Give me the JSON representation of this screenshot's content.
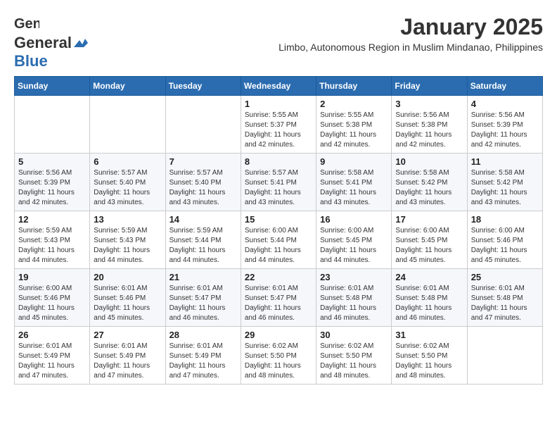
{
  "logo": {
    "general": "General",
    "blue": "Blue"
  },
  "title": {
    "month_year": "January 2025",
    "subtitle": "Limbo, Autonomous Region in Muslim Mindanao, Philippines"
  },
  "headers": [
    "Sunday",
    "Monday",
    "Tuesday",
    "Wednesday",
    "Thursday",
    "Friday",
    "Saturday"
  ],
  "weeks": [
    [
      {
        "num": "",
        "info": ""
      },
      {
        "num": "",
        "info": ""
      },
      {
        "num": "",
        "info": ""
      },
      {
        "num": "1",
        "info": "Sunrise: 5:55 AM\nSunset: 5:37 PM\nDaylight: 11 hours\nand 42 minutes."
      },
      {
        "num": "2",
        "info": "Sunrise: 5:55 AM\nSunset: 5:38 PM\nDaylight: 11 hours\nand 42 minutes."
      },
      {
        "num": "3",
        "info": "Sunrise: 5:56 AM\nSunset: 5:38 PM\nDaylight: 11 hours\nand 42 minutes."
      },
      {
        "num": "4",
        "info": "Sunrise: 5:56 AM\nSunset: 5:39 PM\nDaylight: 11 hours\nand 42 minutes."
      }
    ],
    [
      {
        "num": "5",
        "info": "Sunrise: 5:56 AM\nSunset: 5:39 PM\nDaylight: 11 hours\nand 42 minutes."
      },
      {
        "num": "6",
        "info": "Sunrise: 5:57 AM\nSunset: 5:40 PM\nDaylight: 11 hours\nand 43 minutes."
      },
      {
        "num": "7",
        "info": "Sunrise: 5:57 AM\nSunset: 5:40 PM\nDaylight: 11 hours\nand 43 minutes."
      },
      {
        "num": "8",
        "info": "Sunrise: 5:57 AM\nSunset: 5:41 PM\nDaylight: 11 hours\nand 43 minutes."
      },
      {
        "num": "9",
        "info": "Sunrise: 5:58 AM\nSunset: 5:41 PM\nDaylight: 11 hours\nand 43 minutes."
      },
      {
        "num": "10",
        "info": "Sunrise: 5:58 AM\nSunset: 5:42 PM\nDaylight: 11 hours\nand 43 minutes."
      },
      {
        "num": "11",
        "info": "Sunrise: 5:58 AM\nSunset: 5:42 PM\nDaylight: 11 hours\nand 43 minutes."
      }
    ],
    [
      {
        "num": "12",
        "info": "Sunrise: 5:59 AM\nSunset: 5:43 PM\nDaylight: 11 hours\nand 44 minutes."
      },
      {
        "num": "13",
        "info": "Sunrise: 5:59 AM\nSunset: 5:43 PM\nDaylight: 11 hours\nand 44 minutes."
      },
      {
        "num": "14",
        "info": "Sunrise: 5:59 AM\nSunset: 5:44 PM\nDaylight: 11 hours\nand 44 minutes."
      },
      {
        "num": "15",
        "info": "Sunrise: 6:00 AM\nSunset: 5:44 PM\nDaylight: 11 hours\nand 44 minutes."
      },
      {
        "num": "16",
        "info": "Sunrise: 6:00 AM\nSunset: 5:45 PM\nDaylight: 11 hours\nand 44 minutes."
      },
      {
        "num": "17",
        "info": "Sunrise: 6:00 AM\nSunset: 5:45 PM\nDaylight: 11 hours\nand 45 minutes."
      },
      {
        "num": "18",
        "info": "Sunrise: 6:00 AM\nSunset: 5:46 PM\nDaylight: 11 hours\nand 45 minutes."
      }
    ],
    [
      {
        "num": "19",
        "info": "Sunrise: 6:00 AM\nSunset: 5:46 PM\nDaylight: 11 hours\nand 45 minutes."
      },
      {
        "num": "20",
        "info": "Sunrise: 6:01 AM\nSunset: 5:46 PM\nDaylight: 11 hours\nand 45 minutes."
      },
      {
        "num": "21",
        "info": "Sunrise: 6:01 AM\nSunset: 5:47 PM\nDaylight: 11 hours\nand 46 minutes."
      },
      {
        "num": "22",
        "info": "Sunrise: 6:01 AM\nSunset: 5:47 PM\nDaylight: 11 hours\nand 46 minutes."
      },
      {
        "num": "23",
        "info": "Sunrise: 6:01 AM\nSunset: 5:48 PM\nDaylight: 11 hours\nand 46 minutes."
      },
      {
        "num": "24",
        "info": "Sunrise: 6:01 AM\nSunset: 5:48 PM\nDaylight: 11 hours\nand 46 minutes."
      },
      {
        "num": "25",
        "info": "Sunrise: 6:01 AM\nSunset: 5:48 PM\nDaylight: 11 hours\nand 47 minutes."
      }
    ],
    [
      {
        "num": "26",
        "info": "Sunrise: 6:01 AM\nSunset: 5:49 PM\nDaylight: 11 hours\nand 47 minutes."
      },
      {
        "num": "27",
        "info": "Sunrise: 6:01 AM\nSunset: 5:49 PM\nDaylight: 11 hours\nand 47 minutes."
      },
      {
        "num": "28",
        "info": "Sunrise: 6:01 AM\nSunset: 5:49 PM\nDaylight: 11 hours\nand 47 minutes."
      },
      {
        "num": "29",
        "info": "Sunrise: 6:02 AM\nSunset: 5:50 PM\nDaylight: 11 hours\nand 48 minutes."
      },
      {
        "num": "30",
        "info": "Sunrise: 6:02 AM\nSunset: 5:50 PM\nDaylight: 11 hours\nand 48 minutes."
      },
      {
        "num": "31",
        "info": "Sunrise: 6:02 AM\nSunset: 5:50 PM\nDaylight: 11 hours\nand 48 minutes."
      },
      {
        "num": "",
        "info": ""
      }
    ]
  ]
}
